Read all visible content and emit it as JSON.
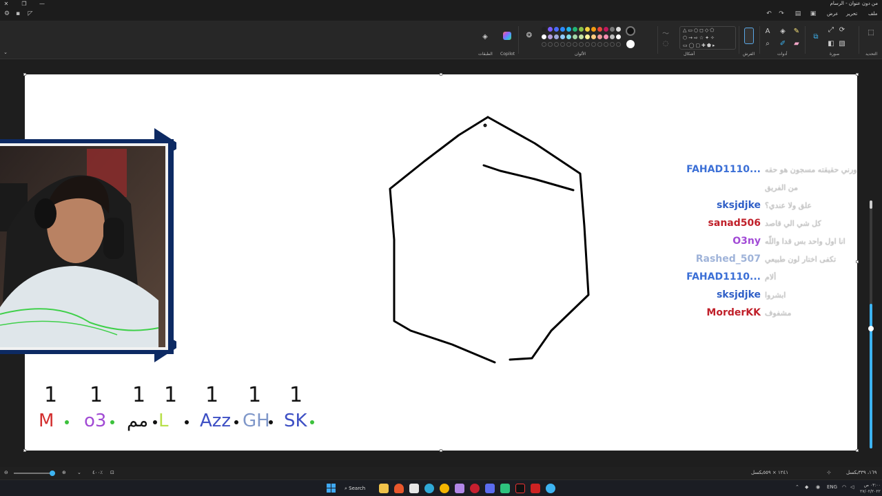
{
  "window": {
    "title": "من دون عنوان - الرسام"
  },
  "menu": {
    "file": "ملف",
    "edit": "تحرير",
    "view": "عرض"
  },
  "ribbon": {
    "groups": {
      "selection": "التحديد",
      "image": "صورة",
      "tools": "أدوات",
      "brushes": "الفرش",
      "shapes": "أشكال",
      "colors": "الألوان",
      "copilot": "Copilot",
      "layers": "الطبقات"
    }
  },
  "colors": {
    "palette_row1": [
      "#222222",
      "#7a5cff",
      "#4b6bff",
      "#2d8cff",
      "#20b4e8",
      "#22b573",
      "#8bc34a",
      "#f4d03f",
      "#f39c12",
      "#e74c3c",
      "#c2185b",
      "#777777",
      "#dddddd"
    ],
    "palette_row2": [
      "#ffffff",
      "#b39ddb",
      "#9fa8da",
      "#90caf9",
      "#80deea",
      "#a5d6a7",
      "#c5e1a5",
      "#fff59d",
      "#ffcc80",
      "#ef9a9a",
      "#f48fb1",
      "#bdbdbd",
      "#ffffff"
    ],
    "primary": "#111111",
    "secondary": "#ffffff"
  },
  "chat": [
    {
      "user": "FAHAD1110...",
      "color": "#3b6fd6",
      "message": "ورني حقيقته مسجون هو حقه"
    },
    {
      "user": "",
      "color": "#3b6fd6",
      "message": "من الفريق"
    },
    {
      "user": "sksjdjke",
      "color": "#2f5fc7",
      "message": "علق ولا عندي؟"
    },
    {
      "user": "sanad506",
      "color": "#c0202a",
      "message": "كل شي الي قاصد"
    },
    {
      "user": "O3ny",
      "color": "#a24bd6",
      "message": "انا اول واحد بس قدا واللّه"
    },
    {
      "user": "Rashed_507",
      "color": "#9fb3d9",
      "message": "تكفى اختار لون طبيعي"
    },
    {
      "user": "FAHAD1110...",
      "color": "#3b6fd6",
      "message": "ألام"
    },
    {
      "user": "sksjdjke",
      "color": "#2f5fc7",
      "message": "ابشروا"
    },
    {
      "user": "MorderKK",
      "color": "#c0202a",
      "message": "مشفوف"
    }
  ],
  "scores": [
    {
      "score": "1",
      "name": "M",
      "color": "#d32f2f",
      "dot": "#3cc13c"
    },
    {
      "score": "1",
      "name": "o3",
      "color": "#a14ad4",
      "dot": "#3cc13c"
    },
    {
      "score": "1",
      "name": "مم",
      "color": "#111111",
      "dot": "#111111"
    },
    {
      "score": "1",
      "name": "L",
      "color": "#b8e04a",
      "dot": "#111111"
    },
    {
      "score": "1",
      "name": "Azz",
      "color": "#3d4fc4",
      "dot": "#111111"
    },
    {
      "score": "1",
      "name": "GH",
      "color": "#7f97c9",
      "dot": "#111111"
    },
    {
      "score": "1",
      "name": "SK",
      "color": "#3d4fc4",
      "dot": "#3cc13c"
    }
  ],
  "status": {
    "zoom": "٤٠٠٪",
    "canvas_size": "١٢٤١ × ٥٥٩بكسل",
    "cursor_pos": "١٦٩، ٣٣٩بكسل"
  },
  "taskbar": {
    "search": "Search",
    "lang": "ENG",
    "time": "٠٣:٠٠ ص",
    "date": "٢٧/٠٢/٢٠٢٢"
  }
}
